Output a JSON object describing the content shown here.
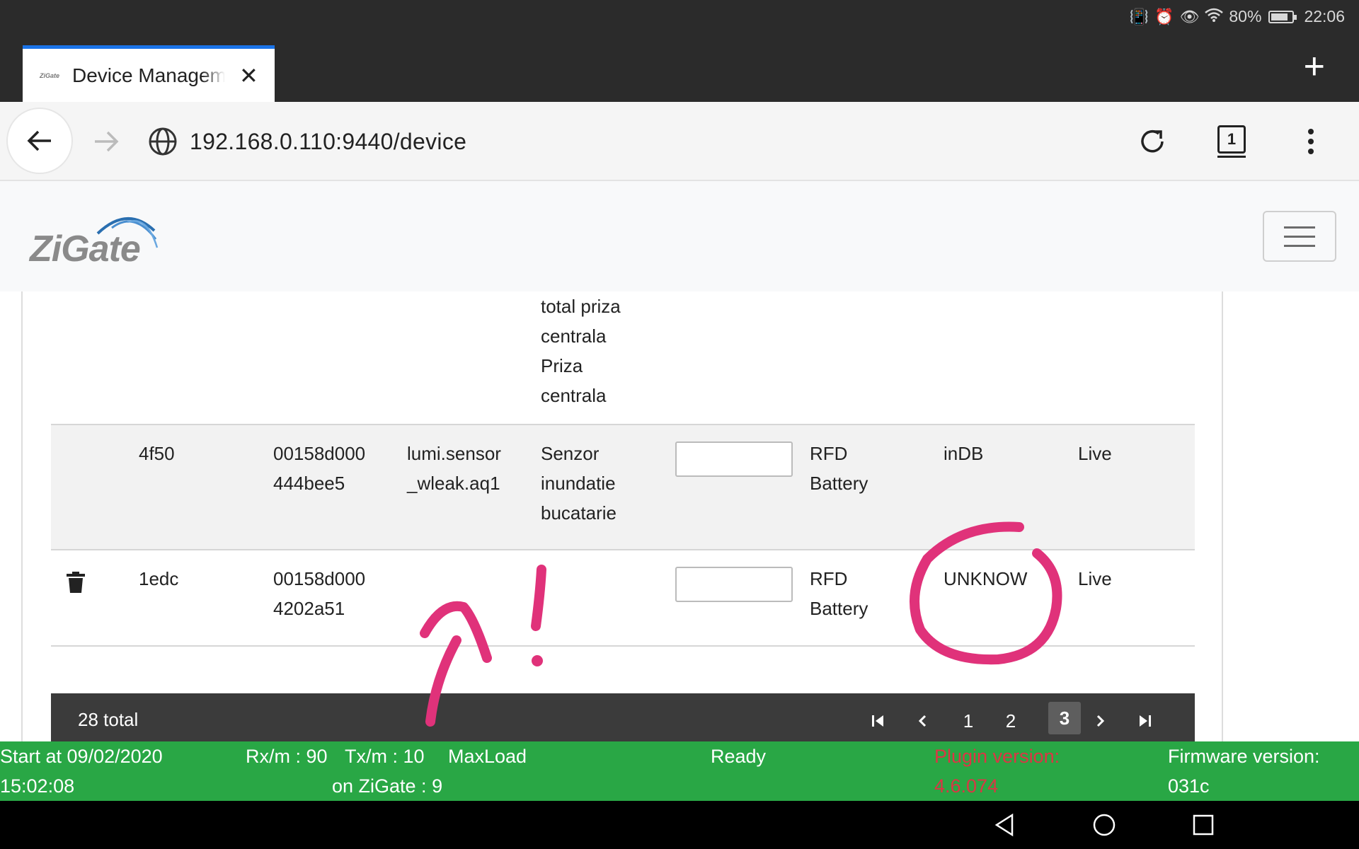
{
  "status_bar": {
    "battery": "80%",
    "time": "22:06",
    "battery_level": 0.8,
    "icons": [
      "vibrate-icon",
      "alarm-icon",
      "eye-comfort-icon",
      "wifi-icon",
      "battery-icon"
    ]
  },
  "browser": {
    "tab_title": "Device Management",
    "tab_count": "1",
    "url": "192.168.0.110:9440/device",
    "favicon_text": "ZiGate"
  },
  "app": {
    "logo_text": "ZiGate"
  },
  "table": {
    "top_partial_lines": [
      "total priza",
      "centrala",
      "Priza",
      "centrala"
    ],
    "rows": [
      {
        "short_addr": "4f50",
        "ieee": [
          "00158d000",
          "444bee5"
        ],
        "model": [
          "lumi.sensor",
          "_wleak.aq1"
        ],
        "name": [
          "Senzor",
          "inundatie",
          "bucatarie"
        ],
        "power": [
          "RFD",
          "Battery"
        ],
        "status": "inDB",
        "health": "Live",
        "highlighted": true
      },
      {
        "short_addr": "1edc",
        "ieee": [
          "00158d000",
          "4202a51"
        ],
        "model": [
          "",
          ""
        ],
        "name": [
          "",
          "",
          ""
        ],
        "power": [
          "RFD",
          "Battery"
        ],
        "status": "UNKNOW",
        "health": "Live",
        "highlighted": false
      }
    ]
  },
  "pager": {
    "total": "28 total",
    "pages": [
      "1",
      "2",
      "3"
    ],
    "active_page": "3"
  },
  "footer": {
    "start": [
      "Start at 09/02/2020",
      "15:02:08"
    ],
    "rx": "Rx/m : 90",
    "tx": "Tx/m : 10",
    "maxload": [
      "MaxLoad",
      "on ZiGate : 9"
    ],
    "state": "Ready",
    "plugin": [
      "Plugin version:",
      "4.6.074"
    ],
    "firmware": [
      "Firmware version:",
      "031c"
    ],
    "plugin_color": "#dc3545"
  },
  "annotation": {
    "color": "#e0327a",
    "mark": "!"
  }
}
